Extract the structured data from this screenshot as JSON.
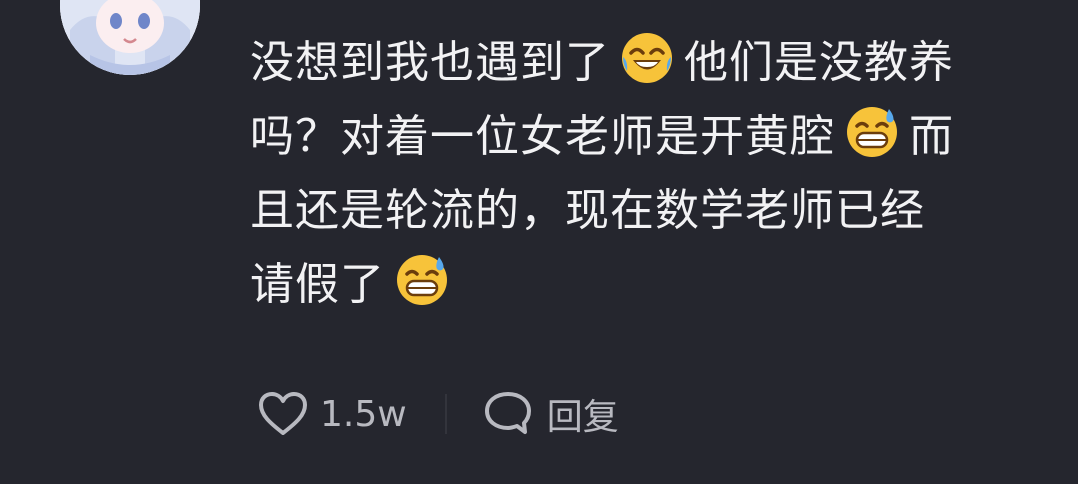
{
  "comment": {
    "lines": [
      {
        "text": "没想到我也遇到了",
        "emoji": "crying-laughing-emoji",
        "after": "他们是没教养"
      },
      {
        "text": "吗？对着一位女老师是开黄腔",
        "emoji": "grinning-sweat-emoji",
        "after": "而"
      },
      {
        "text": "且还是轮流的，现在数学老师已经",
        "emoji": "",
        "after": ""
      },
      {
        "text": "请假了",
        "emoji": "grinning-sweat-emoji",
        "after": ""
      }
    ]
  },
  "actions": {
    "like_icon": "heart-icon",
    "like_count": "1.5w",
    "reply_icon": "speech-bubble-icon",
    "reply_label": "回复"
  },
  "colors": {
    "background": "#25262e",
    "text": "#f2f2f4",
    "muted": "#b8b9c0",
    "emoji_yellow": "#f7c33a"
  }
}
